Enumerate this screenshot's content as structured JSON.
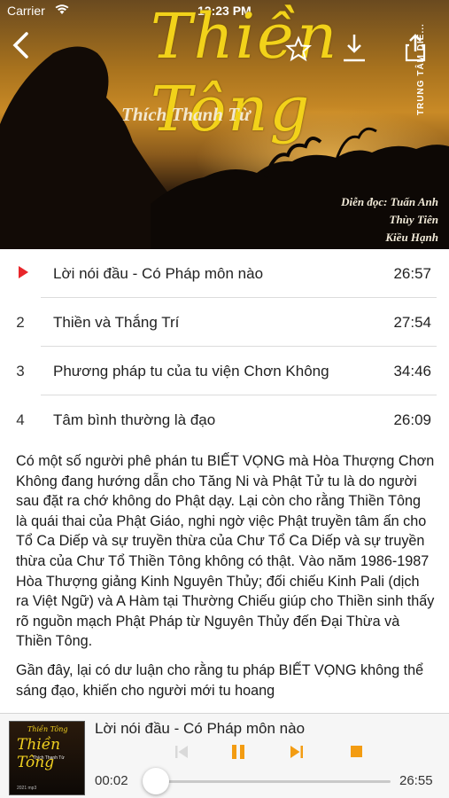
{
  "status_bar": {
    "carrier": "Carrier",
    "time": "12:23 PM"
  },
  "cover": {
    "title": "Thiền Tông",
    "author": "Thích Thanh Từ",
    "side_brand": "TRUNG TÂM DIỄ...",
    "credits": [
      "Diễn đọc: Tuấn Anh",
      "Thùy Tiên",
      "Kiều Hạnh"
    ],
    "icons": [
      "back-chevron-icon",
      "star-outline-icon",
      "download-icon",
      "share-icon"
    ]
  },
  "tracks": [
    {
      "number": "",
      "title": "Lời nói đầu - Có Pháp môn nào",
      "duration": "26:57",
      "playing": true
    },
    {
      "number": "2",
      "title": "Thiền và Thắng Trí",
      "duration": "27:54",
      "playing": false
    },
    {
      "number": "3",
      "title": "Phương pháp tu của tu viện Chơn Không",
      "duration": "34:46",
      "playing": false
    },
    {
      "number": "4",
      "title": "Tâm bình thường là đạo",
      "duration": "26:09",
      "playing": false
    }
  ],
  "description": [
    "Có một số người phê phán tu BIẾT VỌNG mà Hòa Thượng Chơn Không đang hướng dẫn cho Tăng Ni và Phật Tử tu là do người sau đặt ra chớ không do Phật dạy. Lại còn cho rằng Thiền Tông là quái thai của Phật Giáo, nghi ngờ việc Phật truyền tâm ấn cho Tổ Ca Diếp và sự truyền thừa của Chư Tổ Ca Diếp và sự truyền thừa của Chư Tổ Thiền Tông không có thật. Vào năm 1986-1987 Hòa Thượng giảng Kinh Nguyên Thủy; đối chiếu Kinh Pali (dịch ra Việt Ngữ) và A Hàm tại Thường Chiếu giúp cho Thiền sinh thấy rõ nguồn mạch Phật Pháp từ Nguyên Thủy đến Đại Thừa và Thiền Tông.",
    "Gần đây, lại có dư luận cho rằng tu pháp BIẾT VỌNG không thể sáng đạo, khiến cho người mới tu hoang"
  ],
  "player": {
    "now_playing": "Lời nói đầu - Có Pháp môn nào",
    "elapsed": "00:02",
    "total": "26:55",
    "progress_fraction": 0.001,
    "accent_color": "#f39c12",
    "thumb": {
      "title_small": "Thiền Tông",
      "title_big": "Thiền Tông",
      "author": "Thích Thanh Từ",
      "footer": "2021 mp3"
    }
  }
}
